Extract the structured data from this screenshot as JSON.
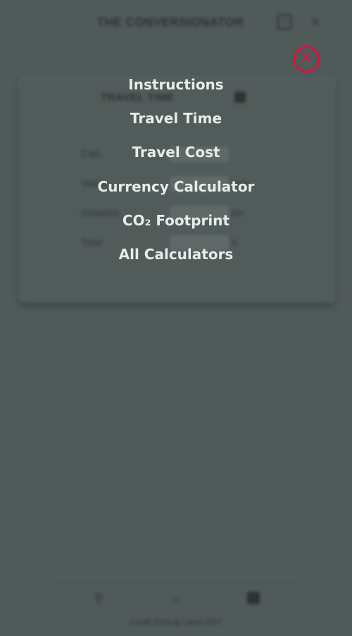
{
  "background": {
    "header_title": "THE CONVERSIONATOR",
    "card": {
      "title": "TRAVEL TIME",
      "rows": [
        {
          "label": "Calc",
          "unit": ""
        },
        {
          "label": "Value",
          "unit": "mph"
        },
        {
          "label": "Distance",
          "unit": "km"
        },
        {
          "label": "Time",
          "unit": "h"
        }
      ]
    },
    "copyright": "Credit 2024 by Lorem EST"
  },
  "menu": {
    "items": [
      "Instructions",
      "Travel Time",
      "Travel Cost",
      "Currency Calculator",
      "CO₂ Footprint",
      "All Calculators"
    ],
    "close_symbol": "✕",
    "close_color": "#e0103b"
  }
}
